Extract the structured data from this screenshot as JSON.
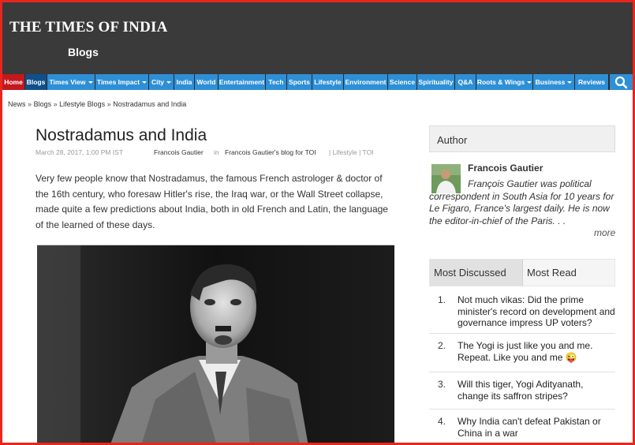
{
  "header": {
    "logo": "THE TIMES OF INDIA",
    "section": "Blogs"
  },
  "nav": {
    "items": [
      {
        "label": "Home",
        "dropdown": false
      },
      {
        "label": "Blogs",
        "dropdown": false
      },
      {
        "label": "Times View",
        "dropdown": true
      },
      {
        "label": "Times Impact",
        "dropdown": true
      },
      {
        "label": "City",
        "dropdown": true
      },
      {
        "label": "India",
        "dropdown": false
      },
      {
        "label": "World",
        "dropdown": false
      },
      {
        "label": "Entertainment",
        "dropdown": false
      },
      {
        "label": "Tech",
        "dropdown": false
      },
      {
        "label": "Sports",
        "dropdown": false
      },
      {
        "label": "Lifestyle",
        "dropdown": false
      },
      {
        "label": "Environment",
        "dropdown": false
      },
      {
        "label": "Science",
        "dropdown": false
      },
      {
        "label": "Spirituality",
        "dropdown": false
      },
      {
        "label": "Q&A",
        "dropdown": false
      },
      {
        "label": "Roots & Wings",
        "dropdown": true
      },
      {
        "label": "Business",
        "dropdown": true
      },
      {
        "label": "Reviews",
        "dropdown": false
      }
    ],
    "search_icon": "search-icon"
  },
  "breadcrumb": {
    "items": [
      "News",
      "Blogs",
      "Lifestyle Blogs",
      "Nostradamus and India"
    ],
    "separator": "»"
  },
  "article": {
    "title": "Nostradamus and India",
    "date": "March 28, 2017, 1:00 PM IST",
    "author": "Francois Gautier",
    "in_label": "in",
    "blog_name": "Francois Gautier's blog for TOI",
    "tags": "| Lifestyle | TOI",
    "intro": "Very few people know that Nostradamus, the famous French astrologer & doctor of the 16th century, who foresaw Hitler's rise, the Iraq war, or the Wall Street collapse, made quite a few predictions about India, both in old French and Latin, the language of the learned of these days."
  },
  "sidebar": {
    "author_box_title": "Author",
    "author_name": "Francois Gautier",
    "author_bio": "François Gautier was political correspondent in South Asia for 10 years for Le Figaro, France's largest daily. He is now the editor-in-chief of the Paris. . .",
    "more_label": "more",
    "tabs": [
      {
        "label": "Most Discussed",
        "active": true
      },
      {
        "label": "Most Read",
        "active": false
      }
    ],
    "list": [
      {
        "num": "1.",
        "text": "Not much vikas: Did the prime minister's record on development and governance impress UP voters?"
      },
      {
        "num": "2.",
        "text": "The Yogi is just like you and me. Repeat. Like you and me 😜"
      },
      {
        "num": "3.",
        "text": "Will this tiger, Yogi Adityanath, change its saffron stripes?"
      },
      {
        "num": "4.",
        "text": "Why India can't defeat Pakistan or China in a war"
      }
    ]
  },
  "colors": {
    "header_bg": "#3a3a3a",
    "nav_blue": "#2e8fd6",
    "home_red": "#c4181f",
    "blogs_dark": "#10508a",
    "frame_red": "#e8261e"
  }
}
